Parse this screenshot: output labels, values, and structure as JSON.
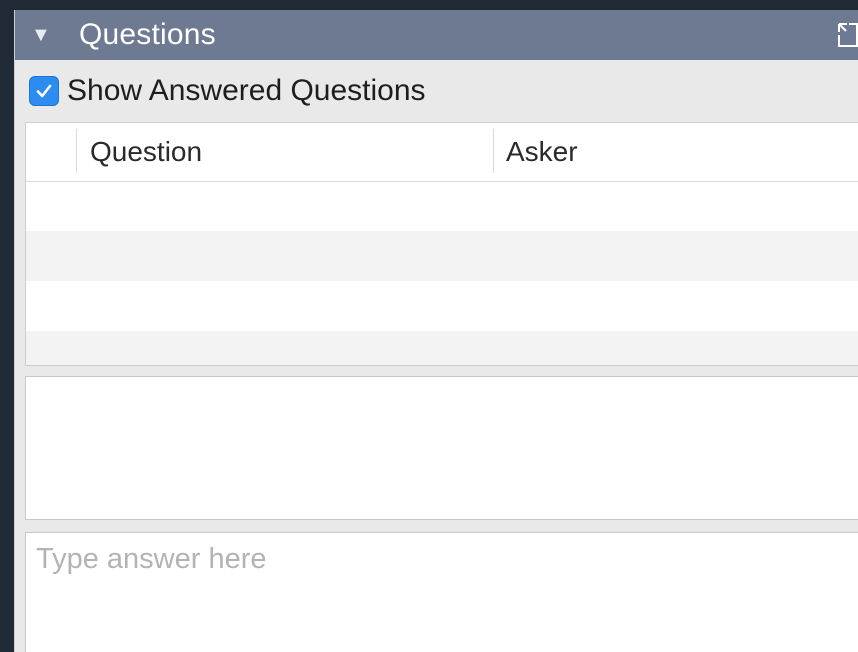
{
  "panel": {
    "title": "Questions",
    "collapse_glyph": "▼",
    "popout_icon": "popout-icon"
  },
  "options": {
    "show_answered_label": "Show Answered Questions",
    "show_answered_checked": true
  },
  "table": {
    "columns": [
      "Question",
      "Asker"
    ],
    "rows": [
      {
        "question": "",
        "asker": ""
      },
      {
        "question": "",
        "asker": ""
      },
      {
        "question": "",
        "asker": ""
      },
      {
        "question": "",
        "asker": ""
      }
    ]
  },
  "selected_question_text": "",
  "answer": {
    "placeholder": "Type answer here",
    "value": ""
  },
  "colors": {
    "titlebar": "#6d7a92",
    "checkbox": "#2d8cf0",
    "background": "#1f2a36"
  }
}
